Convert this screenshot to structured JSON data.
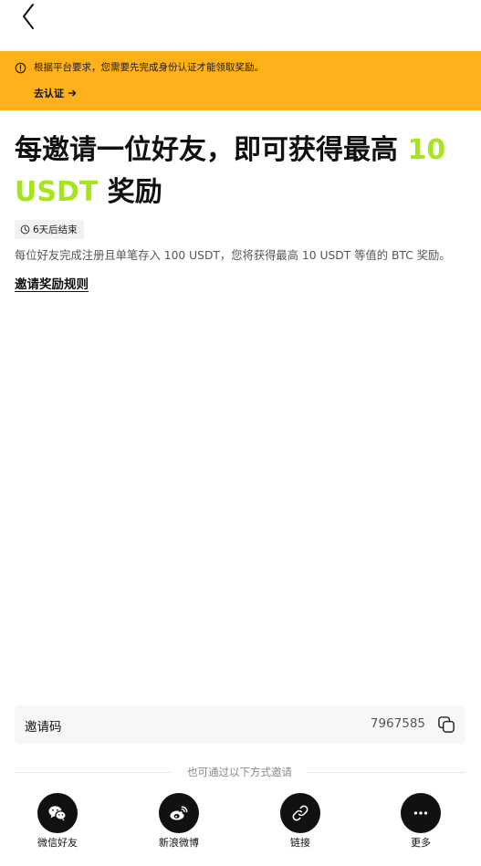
{
  "header": {
    "back_icon": "chevron-left-icon"
  },
  "banner": {
    "background": "#ffb11b",
    "icon": "info-icon",
    "message": "根据平台要求，您需要先完成身份认证才能领取奖励。",
    "action_label": "去认证",
    "action_icon": "arrow-right-icon"
  },
  "headline": {
    "prefix": "每邀请一位好友，即可获得最高 ",
    "highlight": "10 USDT",
    "suffix": " 奖励",
    "highlight_color": "#a5e51d"
  },
  "timer": {
    "icon": "clock-icon",
    "label": "6天后结束"
  },
  "description": "每位好友完成注册且单笔存入 100 USDT，您将获得最高  10 USDT 等值的 BTC 奖励。",
  "rules_link": "邀请奖励规则",
  "invite_code": {
    "label": "邀请码",
    "value": "7967585",
    "copy_icon": "copy-icon"
  },
  "share": {
    "divider_text": "也可通过以下方式邀请",
    "options": [
      {
        "label": "微信好友",
        "icon": "wechat-icon"
      },
      {
        "label": "新浪微博",
        "icon": "weibo-icon"
      },
      {
        "label": "链接",
        "icon": "link-icon"
      },
      {
        "label": "更多",
        "icon": "more-icon"
      }
    ]
  }
}
